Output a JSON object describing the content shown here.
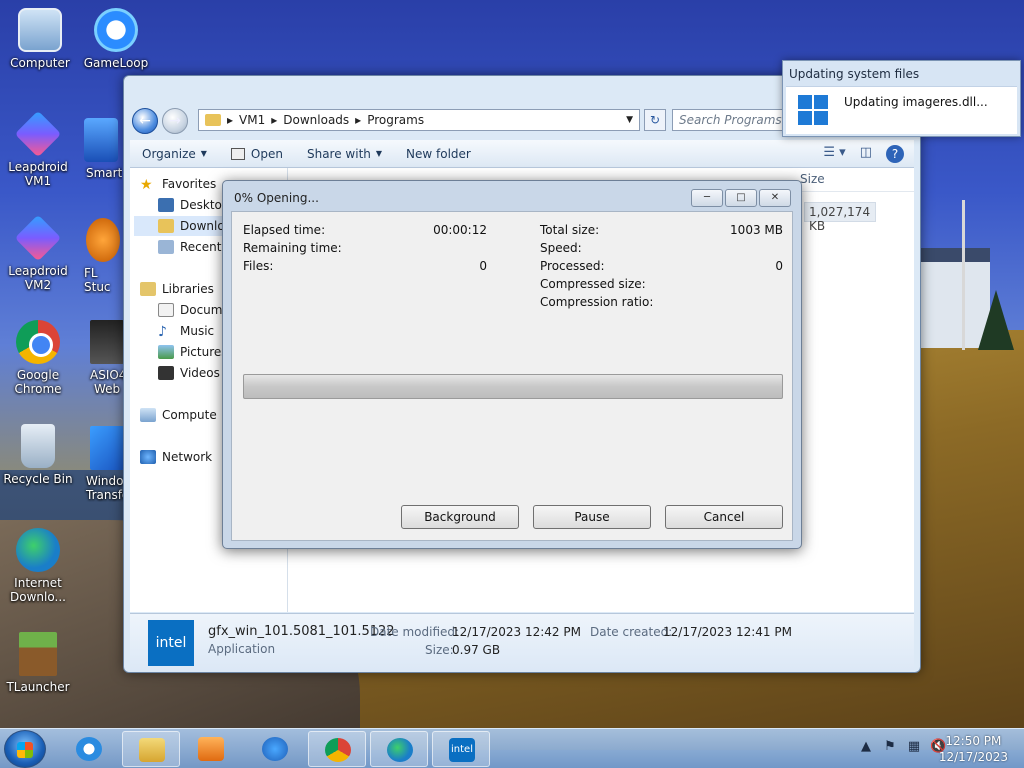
{
  "desktop": {
    "icons": [
      {
        "label_line1": "Computer",
        "label_line2": ""
      },
      {
        "label_line1": "GameLoop",
        "label_line2": ""
      },
      {
        "label_line1": "Leapdroid",
        "label_line2": "VM1"
      },
      {
        "label_line1": "SmartG",
        "label_line2": ""
      },
      {
        "label_line1": "Leapdroid",
        "label_line2": "VM2"
      },
      {
        "label_line1": "FL Stuc",
        "label_line2": ""
      },
      {
        "label_line1": "Google",
        "label_line2": "Chrome"
      },
      {
        "label_line1": "ASIO4",
        "label_line2": "Web"
      },
      {
        "label_line1": "Recycle Bin",
        "label_line2": ""
      },
      {
        "label_line1": "Windo",
        "label_line2": "Transfo"
      },
      {
        "label_line1": "Internet",
        "label_line2": "Downlo..."
      },
      {
        "label_line1": "TLauncher",
        "label_line2": ""
      }
    ]
  },
  "explorer": {
    "breadcrumb": [
      "VM1",
      "Downloads",
      "Programs"
    ],
    "search_placeholder": "Search Programs",
    "toolbar": {
      "organize": "Organize",
      "open": "Open",
      "share_with": "Share with",
      "new_folder": "New folder"
    },
    "nav": {
      "favorites": "Favorites",
      "desktop": "Desktop",
      "downloads": "Downlo",
      "recent": "Recent P",
      "libraries": "Libraries",
      "documents": "Docume",
      "music": "Music",
      "pictures": "Pictures",
      "videos": "Videos",
      "computer": "Compute",
      "network": "Network"
    },
    "columns": {
      "size": "Size"
    },
    "file_size_cell": "1,027,174 KB",
    "details": {
      "file_name": "gfx_win_101.5081_101.5122",
      "file_type": "Application",
      "date_modified_label": "Date modified:",
      "date_modified": "12/17/2023 12:42 PM",
      "date_created_label": "Date created:",
      "date_created": "12/17/2023 12:41 PM",
      "size_label": "Size:",
      "size": "0.97 GB",
      "icon_text": "intel"
    }
  },
  "dialog": {
    "title": "0% Opening...",
    "left": [
      {
        "label": "Elapsed time:",
        "value": "00:00:12"
      },
      {
        "label": "Remaining time:",
        "value": ""
      },
      {
        "label": "Files:",
        "value": "0"
      }
    ],
    "right": [
      {
        "label": "Total size:",
        "value": "1003 MB"
      },
      {
        "label": "Speed:",
        "value": ""
      },
      {
        "label": "Processed:",
        "value": "0"
      },
      {
        "label": "Compressed size:",
        "value": ""
      },
      {
        "label": "Compression ratio:",
        "value": ""
      }
    ],
    "progress_fraction": 0,
    "buttons": {
      "background": "Background",
      "pause": "Pause",
      "cancel": "Cancel"
    }
  },
  "notification": {
    "title": "Updating system files",
    "message": "Updating imageres.dll..."
  },
  "taskbar": {
    "intel_text": "intel",
    "time": "12:50 PM",
    "date": "12/17/2023"
  }
}
